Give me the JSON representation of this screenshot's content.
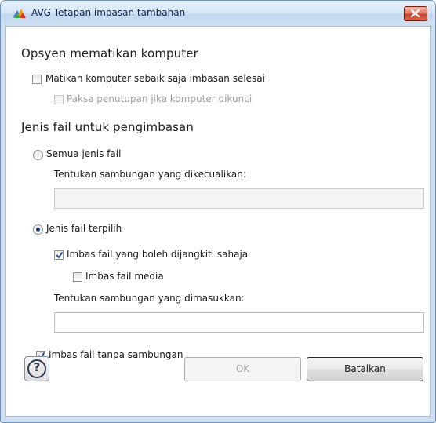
{
  "window": {
    "title": "AVG Tetapan imbasan tambahan"
  },
  "shutdown_section": {
    "title": "Opsyen mematikan komputer",
    "shutdown_after_scan": {
      "label": "Matikan komputer sebaik saja imbasan selesai",
      "checked": false
    },
    "force_if_locked": {
      "label": "Paksa penutupan jika komputer dikunci",
      "checked": false,
      "disabled": true
    }
  },
  "file_types_section": {
    "title": "Jenis fail untuk pengimbasan",
    "all_types": {
      "label": "Semua jenis fail",
      "selected": false
    },
    "excluded_extensions": {
      "label": "Tentukan sambungan yang dikecualikan:",
      "value": "",
      "disabled": true
    },
    "selected_types": {
      "label": "Jenis fail terpilih",
      "selected": true
    },
    "scan_infectable_only": {
      "label": "Imbas fail yang boleh dijangkiti sahaja",
      "checked": true
    },
    "scan_media": {
      "label": "Imbas fail media",
      "checked": false
    },
    "included_extensions": {
      "label": "Tentukan sambungan yang dimasukkan:",
      "value": ""
    },
    "scan_no_extension": {
      "label": "Imbas fail tanpa sambungan",
      "checked": true
    }
  },
  "buttons": {
    "help": "?",
    "ok": "OK",
    "cancel": "Batalkan"
  },
  "colors": {
    "accent": "#1c3f8a",
    "titlebar": "#cfe0f3",
    "close": "#c8422a",
    "disabled_text": "#a0a0a0"
  }
}
